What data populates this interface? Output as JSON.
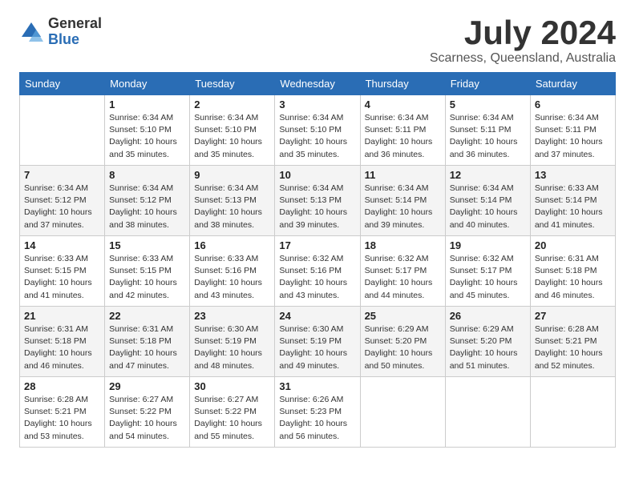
{
  "logo": {
    "general": "General",
    "blue": "Blue"
  },
  "title": "July 2024",
  "subtitle": "Scarness, Queensland, Australia",
  "days": [
    "Sunday",
    "Monday",
    "Tuesday",
    "Wednesday",
    "Thursday",
    "Friday",
    "Saturday"
  ],
  "weeks": [
    [
      {
        "day": "",
        "sunrise": "",
        "sunset": "",
        "daylight": ""
      },
      {
        "day": "1",
        "sunrise": "Sunrise: 6:34 AM",
        "sunset": "Sunset: 5:10 PM",
        "daylight": "Daylight: 10 hours and 35 minutes."
      },
      {
        "day": "2",
        "sunrise": "Sunrise: 6:34 AM",
        "sunset": "Sunset: 5:10 PM",
        "daylight": "Daylight: 10 hours and 35 minutes."
      },
      {
        "day": "3",
        "sunrise": "Sunrise: 6:34 AM",
        "sunset": "Sunset: 5:10 PM",
        "daylight": "Daylight: 10 hours and 35 minutes."
      },
      {
        "day": "4",
        "sunrise": "Sunrise: 6:34 AM",
        "sunset": "Sunset: 5:11 PM",
        "daylight": "Daylight: 10 hours and 36 minutes."
      },
      {
        "day": "5",
        "sunrise": "Sunrise: 6:34 AM",
        "sunset": "Sunset: 5:11 PM",
        "daylight": "Daylight: 10 hours and 36 minutes."
      },
      {
        "day": "6",
        "sunrise": "Sunrise: 6:34 AM",
        "sunset": "Sunset: 5:11 PM",
        "daylight": "Daylight: 10 hours and 37 minutes."
      }
    ],
    [
      {
        "day": "7",
        "sunrise": "Sunrise: 6:34 AM",
        "sunset": "Sunset: 5:12 PM",
        "daylight": "Daylight: 10 hours and 37 minutes."
      },
      {
        "day": "8",
        "sunrise": "Sunrise: 6:34 AM",
        "sunset": "Sunset: 5:12 PM",
        "daylight": "Daylight: 10 hours and 38 minutes."
      },
      {
        "day": "9",
        "sunrise": "Sunrise: 6:34 AM",
        "sunset": "Sunset: 5:13 PM",
        "daylight": "Daylight: 10 hours and 38 minutes."
      },
      {
        "day": "10",
        "sunrise": "Sunrise: 6:34 AM",
        "sunset": "Sunset: 5:13 PM",
        "daylight": "Daylight: 10 hours and 39 minutes."
      },
      {
        "day": "11",
        "sunrise": "Sunrise: 6:34 AM",
        "sunset": "Sunset: 5:14 PM",
        "daylight": "Daylight: 10 hours and 39 minutes."
      },
      {
        "day": "12",
        "sunrise": "Sunrise: 6:34 AM",
        "sunset": "Sunset: 5:14 PM",
        "daylight": "Daylight: 10 hours and 40 minutes."
      },
      {
        "day": "13",
        "sunrise": "Sunrise: 6:33 AM",
        "sunset": "Sunset: 5:14 PM",
        "daylight": "Daylight: 10 hours and 41 minutes."
      }
    ],
    [
      {
        "day": "14",
        "sunrise": "Sunrise: 6:33 AM",
        "sunset": "Sunset: 5:15 PM",
        "daylight": "Daylight: 10 hours and 41 minutes."
      },
      {
        "day": "15",
        "sunrise": "Sunrise: 6:33 AM",
        "sunset": "Sunset: 5:15 PM",
        "daylight": "Daylight: 10 hours and 42 minutes."
      },
      {
        "day": "16",
        "sunrise": "Sunrise: 6:33 AM",
        "sunset": "Sunset: 5:16 PM",
        "daylight": "Daylight: 10 hours and 43 minutes."
      },
      {
        "day": "17",
        "sunrise": "Sunrise: 6:32 AM",
        "sunset": "Sunset: 5:16 PM",
        "daylight": "Daylight: 10 hours and 43 minutes."
      },
      {
        "day": "18",
        "sunrise": "Sunrise: 6:32 AM",
        "sunset": "Sunset: 5:17 PM",
        "daylight": "Daylight: 10 hours and 44 minutes."
      },
      {
        "day": "19",
        "sunrise": "Sunrise: 6:32 AM",
        "sunset": "Sunset: 5:17 PM",
        "daylight": "Daylight: 10 hours and 45 minutes."
      },
      {
        "day": "20",
        "sunrise": "Sunrise: 6:31 AM",
        "sunset": "Sunset: 5:18 PM",
        "daylight": "Daylight: 10 hours and 46 minutes."
      }
    ],
    [
      {
        "day": "21",
        "sunrise": "Sunrise: 6:31 AM",
        "sunset": "Sunset: 5:18 PM",
        "daylight": "Daylight: 10 hours and 46 minutes."
      },
      {
        "day": "22",
        "sunrise": "Sunrise: 6:31 AM",
        "sunset": "Sunset: 5:18 PM",
        "daylight": "Daylight: 10 hours and 47 minutes."
      },
      {
        "day": "23",
        "sunrise": "Sunrise: 6:30 AM",
        "sunset": "Sunset: 5:19 PM",
        "daylight": "Daylight: 10 hours and 48 minutes."
      },
      {
        "day": "24",
        "sunrise": "Sunrise: 6:30 AM",
        "sunset": "Sunset: 5:19 PM",
        "daylight": "Daylight: 10 hours and 49 minutes."
      },
      {
        "day": "25",
        "sunrise": "Sunrise: 6:29 AM",
        "sunset": "Sunset: 5:20 PM",
        "daylight": "Daylight: 10 hours and 50 minutes."
      },
      {
        "day": "26",
        "sunrise": "Sunrise: 6:29 AM",
        "sunset": "Sunset: 5:20 PM",
        "daylight": "Daylight: 10 hours and 51 minutes."
      },
      {
        "day": "27",
        "sunrise": "Sunrise: 6:28 AM",
        "sunset": "Sunset: 5:21 PM",
        "daylight": "Daylight: 10 hours and 52 minutes."
      }
    ],
    [
      {
        "day": "28",
        "sunrise": "Sunrise: 6:28 AM",
        "sunset": "Sunset: 5:21 PM",
        "daylight": "Daylight: 10 hours and 53 minutes."
      },
      {
        "day": "29",
        "sunrise": "Sunrise: 6:27 AM",
        "sunset": "Sunset: 5:22 PM",
        "daylight": "Daylight: 10 hours and 54 minutes."
      },
      {
        "day": "30",
        "sunrise": "Sunrise: 6:27 AM",
        "sunset": "Sunset: 5:22 PM",
        "daylight": "Daylight: 10 hours and 55 minutes."
      },
      {
        "day": "31",
        "sunrise": "Sunrise: 6:26 AM",
        "sunset": "Sunset: 5:23 PM",
        "daylight": "Daylight: 10 hours and 56 minutes."
      },
      {
        "day": "",
        "sunrise": "",
        "sunset": "",
        "daylight": ""
      },
      {
        "day": "",
        "sunrise": "",
        "sunset": "",
        "daylight": ""
      },
      {
        "day": "",
        "sunrise": "",
        "sunset": "",
        "daylight": ""
      }
    ]
  ]
}
